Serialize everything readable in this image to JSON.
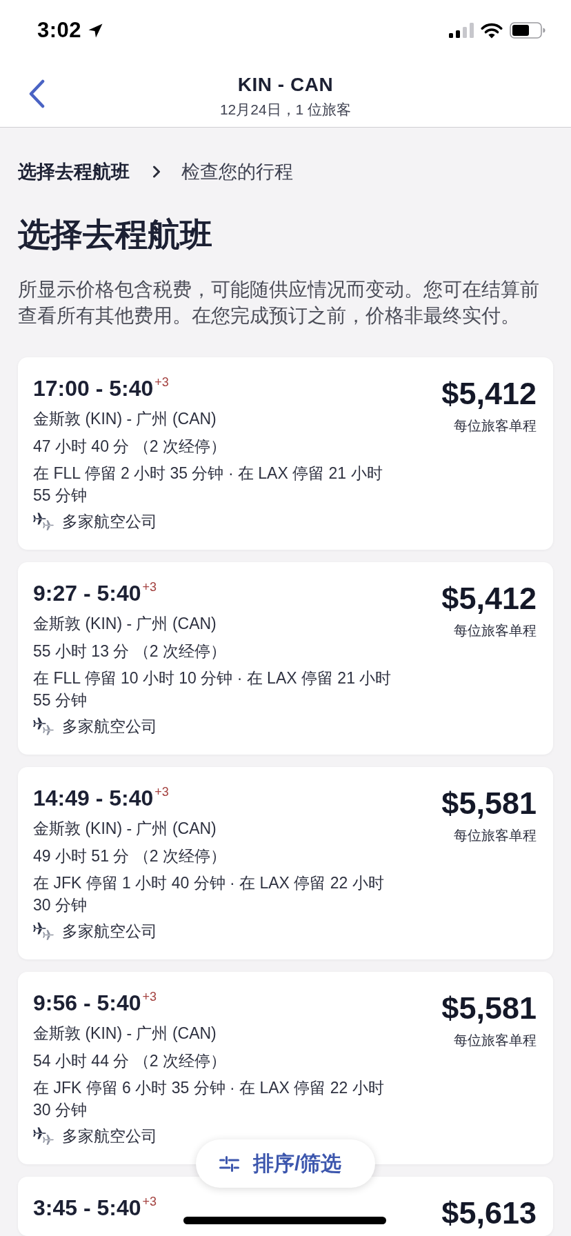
{
  "status_bar": {
    "time": "3:02"
  },
  "header": {
    "title": "KIN - CAN",
    "subtitle": "12月24日，1 位旅客"
  },
  "breadcrumb": [
    {
      "label": "选择去程航班",
      "current": true
    },
    {
      "label": "检查您的行程",
      "current": false
    }
  ],
  "heading": "选择去程航班",
  "notice": "所显示价格包含税费，可能随供应情况而变动。您可在结算前查看所有其他费用。在您完成预订之前，价格非最终实付。",
  "flights": [
    {
      "times": "17:00 - 5:40",
      "day_offset": "+3",
      "route": "金斯敦 (KIN) - 广州 (CAN)",
      "duration": "47 小时 40 分 （2 次经停）",
      "layovers": "在 FLL 停留 2 小时 35 分钟 · 在 LAX 停留 21 小时 55 分钟",
      "airline": "多家航空公司",
      "price": "$5,412",
      "price_note": "每位旅客单程"
    },
    {
      "times": "9:27 - 5:40",
      "day_offset": "+3",
      "route": "金斯敦 (KIN) - 广州 (CAN)",
      "duration": "55 小时 13 分 （2 次经停）",
      "layovers": "在 FLL 停留 10 小时 10 分钟 · 在 LAX 停留 21 小时 55 分钟",
      "airline": "多家航空公司",
      "price": "$5,412",
      "price_note": "每位旅客单程"
    },
    {
      "times": "14:49 - 5:40",
      "day_offset": "+3",
      "route": "金斯敦 (KIN) - 广州 (CAN)",
      "duration": "49 小时 51 分 （2 次经停）",
      "layovers": "在 JFK 停留 1 小时 40 分钟 · 在 LAX 停留 22 小时 30 分钟",
      "airline": "多家航空公司",
      "price": "$5,581",
      "price_note": "每位旅客单程"
    },
    {
      "times": "9:56 - 5:40",
      "day_offset": "+3",
      "route": "金斯敦 (KIN) - 广州 (CAN)",
      "duration": "54 小时 44 分 （2 次经停）",
      "layovers": "在 JFK 停留 6 小时 35 分钟 · 在 LAX 停留 22 小时 30 分钟",
      "airline": "多家航空公司",
      "price": "$5,581",
      "price_note": "每位旅客单程"
    },
    {
      "times": "3:45 - 5:40",
      "day_offset": "+3",
      "price": "$5,613"
    }
  ],
  "sort_filter_button": {
    "label": "排序/筛选"
  }
}
